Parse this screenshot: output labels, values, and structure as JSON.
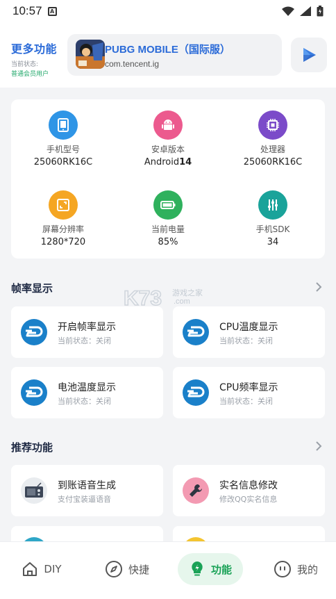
{
  "status_bar": {
    "time": "10:57",
    "notification_letter": "A"
  },
  "header": {
    "brand_title": "更多功能",
    "status_label": "当前状态:",
    "status_value": "普通会员用户",
    "app_name": "PUBG MOBILE（国际服）",
    "app_package": "com.tencent.ig"
  },
  "device_info": [
    {
      "label": "手机型号",
      "value": "25060RK16C",
      "icon": "tablet-icon",
      "color": "#2f95e6"
    },
    {
      "label": "安卓版本",
      "value_prefix": "Android",
      "value_bold": "14",
      "icon": "android-icon",
      "color": "#ec5a8e"
    },
    {
      "label": "处理器",
      "value": "25060RK16C",
      "icon": "cpu-icon",
      "color": "#7b4bc9"
    },
    {
      "label": "屏幕分辨率",
      "value": "1280*720",
      "icon": "screen-icon",
      "color": "#f5a623"
    },
    {
      "label": "当前电量",
      "value": "85%",
      "icon": "battery-icon",
      "color": "#2fb15d"
    },
    {
      "label": "手机SDK",
      "value": "34",
      "icon": "sliders-icon",
      "color": "#1aa39a"
    }
  ],
  "sections": {
    "frame_rate": {
      "title": "帧率显示",
      "tiles": [
        {
          "title": "开启帧率显示",
          "subtitle": "当前状态：关闭"
        },
        {
          "title": "CPU温度显示",
          "subtitle": "当前状态：关闭"
        },
        {
          "title": "电池温度显示",
          "subtitle": "当前状态：关闭"
        },
        {
          "title": "CPU频率显示",
          "subtitle": "当前状态：关闭"
        }
      ]
    },
    "recommended": {
      "title": "推荐功能",
      "tiles": [
        {
          "title": "到账语音生成",
          "subtitle": "支付宝装逼语音"
        },
        {
          "title": "实名信息修改",
          "subtitle": "修改QQ实名信息"
        }
      ]
    }
  },
  "watermark": {
    "text": "游戏之家",
    "sub": ".com"
  },
  "bottom_nav": [
    {
      "label": "DIY",
      "icon": "home-icon"
    },
    {
      "label": "快捷",
      "icon": "compass-icon"
    },
    {
      "label": "功能",
      "icon": "bulb-icon",
      "active": true
    },
    {
      "label": "我的",
      "icon": "face-icon"
    }
  ],
  "colors": {
    "accent_blue": "#2b6bd8",
    "accent_green": "#1aa257",
    "dash_blue": "#1a80c9"
  }
}
